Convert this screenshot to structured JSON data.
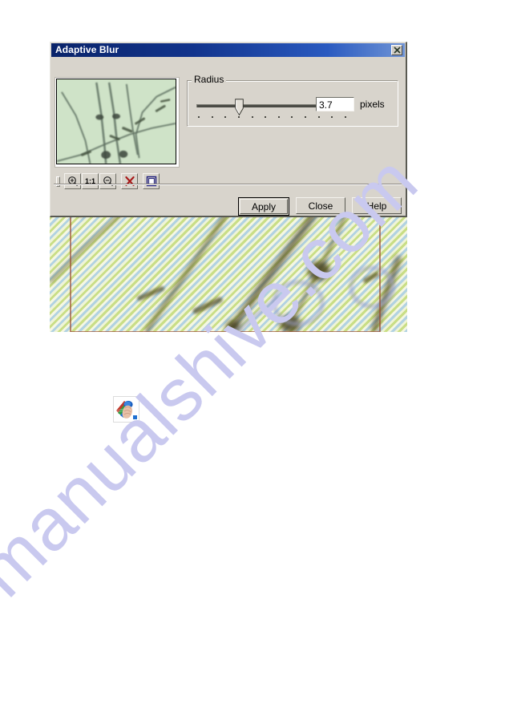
{
  "dialog": {
    "title": "Adaptive Blur",
    "close_icon": "close-icon",
    "preview": {
      "alt": "filter-preview-thumbnail"
    },
    "toolbar": {
      "grip": "toolbar-grip",
      "buttons": [
        {
          "name": "zoom-in-icon",
          "label": ""
        },
        {
          "name": "zoom-actual-size-button",
          "label": "1:1"
        },
        {
          "name": "zoom-out-icon",
          "label": ""
        },
        {
          "name": "reset-icon",
          "label": ""
        },
        {
          "name": "preview-toggle-icon",
          "label": ""
        }
      ]
    },
    "radius": {
      "legend": "Radius",
      "value": "3.7",
      "units": "pixels",
      "slider_position_percent": 26,
      "tick_count": 12
    },
    "buttons": {
      "apply": "Apply",
      "close": "Close",
      "help": "Help"
    }
  },
  "document": {
    "image_name": "blurred-map-screenshot",
    "selection_rect": "red-selection-rectangle"
  },
  "page": {
    "icon_name": "color-picker-hand-icon"
  },
  "watermark": {
    "text": "manualshive.com",
    "color": "#c9c9ef"
  }
}
